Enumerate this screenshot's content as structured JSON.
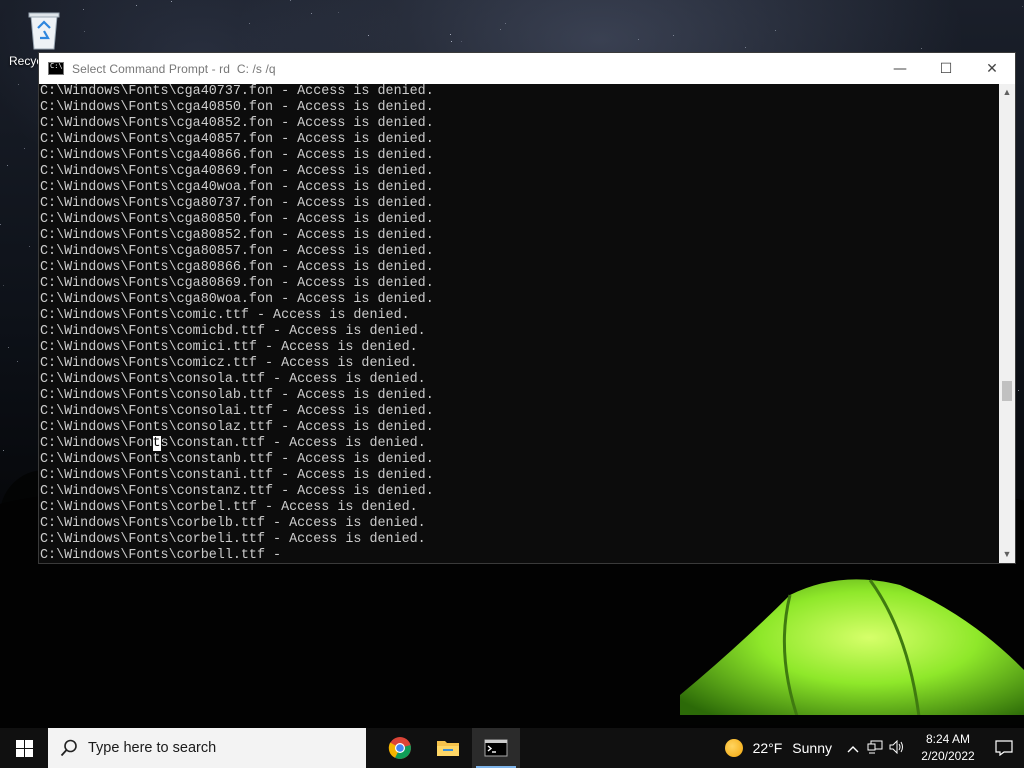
{
  "desktop": {
    "recycle_bin_label": "Recyc"
  },
  "window": {
    "title": "Select Command Prompt - rd  C: /s /q",
    "minimize_glyph": "—",
    "maximize_glyph": "☐",
    "close_glyph": "✕",
    "console_lines": [
      "C:\\Windows\\Fonts\\cga40737.fon - Access is denied.",
      "C:\\Windows\\Fonts\\cga40850.fon - Access is denied.",
      "C:\\Windows\\Fonts\\cga40852.fon - Access is denied.",
      "C:\\Windows\\Fonts\\cga40857.fon - Access is denied.",
      "C:\\Windows\\Fonts\\cga40866.fon - Access is denied.",
      "C:\\Windows\\Fonts\\cga40869.fon - Access is denied.",
      "C:\\Windows\\Fonts\\cga40woa.fon - Access is denied.",
      "C:\\Windows\\Fonts\\cga80737.fon - Access is denied.",
      "C:\\Windows\\Fonts\\cga80850.fon - Access is denied.",
      "C:\\Windows\\Fonts\\cga80852.fon - Access is denied.",
      "C:\\Windows\\Fonts\\cga80857.fon - Access is denied.",
      "C:\\Windows\\Fonts\\cga80866.fon - Access is denied.",
      "C:\\Windows\\Fonts\\cga80869.fon - Access is denied.",
      "C:\\Windows\\Fonts\\cga80woa.fon - Access is denied.",
      "C:\\Windows\\Fonts\\comic.ttf - Access is denied.",
      "C:\\Windows\\Fonts\\comicbd.ttf - Access is denied.",
      "C:\\Windows\\Fonts\\comici.ttf - Access is denied.",
      "C:\\Windows\\Fonts\\comicz.ttf - Access is denied.",
      "C:\\Windows\\Fonts\\consola.ttf - Access is denied.",
      "C:\\Windows\\Fonts\\consolab.ttf - Access is denied.",
      "C:\\Windows\\Fonts\\consolai.ttf - Access is denied.",
      "C:\\Windows\\Fonts\\consolaz.ttf - Access is denied.",
      "C:\\Windows\\Fonts\\constan.ttf - Access is denied.",
      "C:\\Windows\\Fonts\\constanb.ttf - Access is denied.",
      "C:\\Windows\\Fonts\\constani.ttf - Access is denied.",
      "C:\\Windows\\Fonts\\constanz.ttf - Access is denied.",
      "C:\\Windows\\Fonts\\corbel.ttf - Access is denied.",
      "C:\\Windows\\Fonts\\corbelb.ttf - Access is denied.",
      "C:\\Windows\\Fonts\\corbeli.ttf - Access is denied.",
      "C:\\Windows\\Fonts\\corbell.ttf -"
    ],
    "selection": {
      "line_index": 22,
      "char_index": 14
    }
  },
  "taskbar": {
    "search_placeholder": "Type here to search",
    "apps": [
      {
        "name": "chrome-icon",
        "active": false
      },
      {
        "name": "file-explorer-icon",
        "active": false
      },
      {
        "name": "command-prompt-icon",
        "active": true
      }
    ],
    "weather": {
      "temperature": "22°F",
      "condition": "Sunny"
    },
    "tray_icons": [
      "chevron-up-icon",
      "network-icon",
      "volume-icon"
    ],
    "clock": {
      "time": "8:24 AM",
      "date": "2/20/2022"
    }
  },
  "colors": {
    "console_bg": "#0c0c0c",
    "console_text": "#cccccc",
    "taskbar_bg": "#101010",
    "active_indicator": "#7eb4ea",
    "tent_green": "#8fe82a"
  }
}
